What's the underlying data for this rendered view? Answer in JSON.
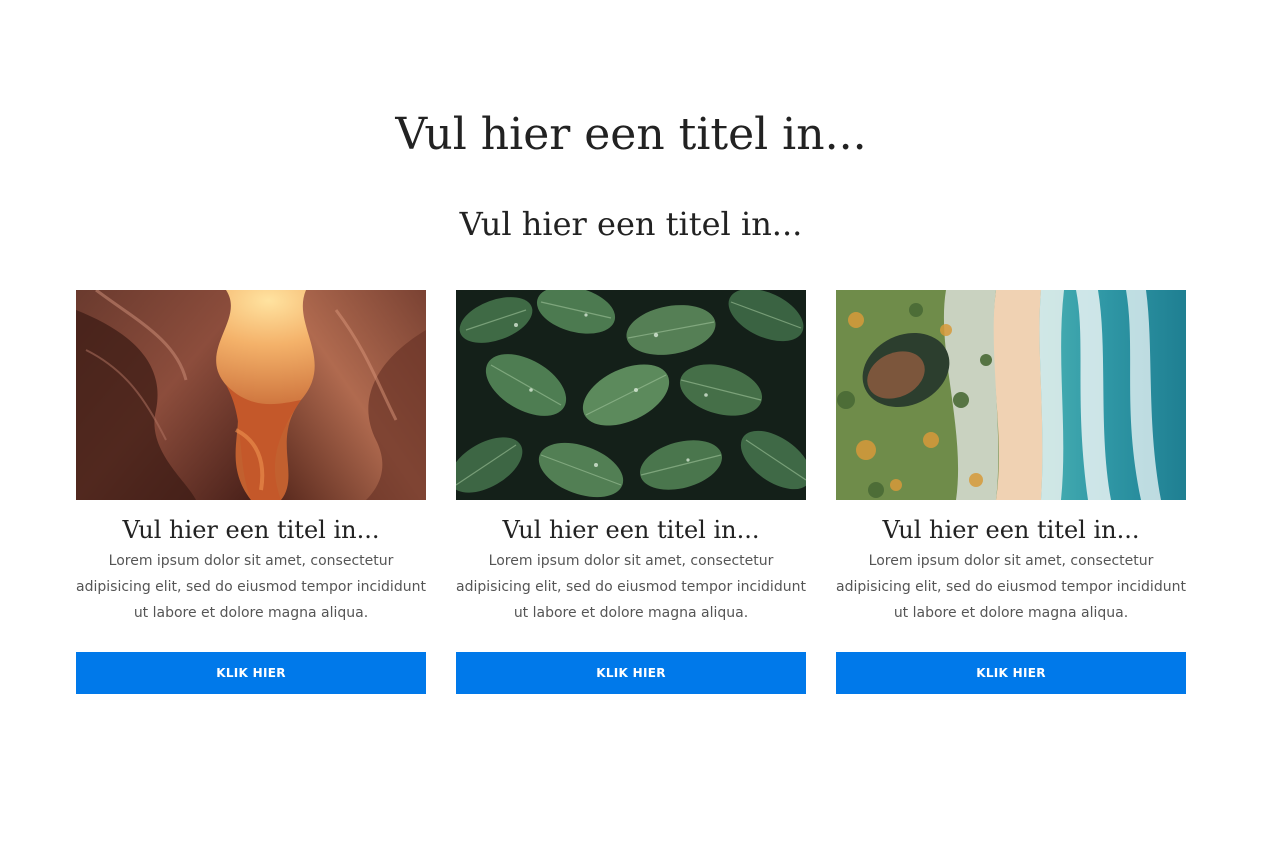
{
  "header": {
    "title": "Vul hier een titel in...",
    "subtitle": "Vul hier een titel in..."
  },
  "theme": {
    "button_color": "#0079EA",
    "text_color": "#222222",
    "body_text_color": "#555555"
  },
  "cards": [
    {
      "image": "canyon-photo",
      "title": "Vul hier een titel in...",
      "text": "Lorem ipsum dolor sit amet, consectetur adipisicing elit, sed do eiusmod tempor incididunt ut labore et dolore magna aliqua.",
      "button_label": "KLIK HIER"
    },
    {
      "image": "leaves-photo",
      "title": "Vul hier een titel in...",
      "text": "Lorem ipsum dolor sit amet, consectetur adipisicing elit, sed do eiusmod tempor incididunt ut labore et dolore magna aliqua.",
      "button_label": "KLIK HIER"
    },
    {
      "image": "beach-aerial-photo",
      "title": "Vul hier een titel in...",
      "text": "Lorem ipsum dolor sit amet, consectetur adipisicing elit, sed do eiusmod tempor incididunt ut labore et dolore magna aliqua.",
      "button_label": "KLIK HIER"
    }
  ]
}
